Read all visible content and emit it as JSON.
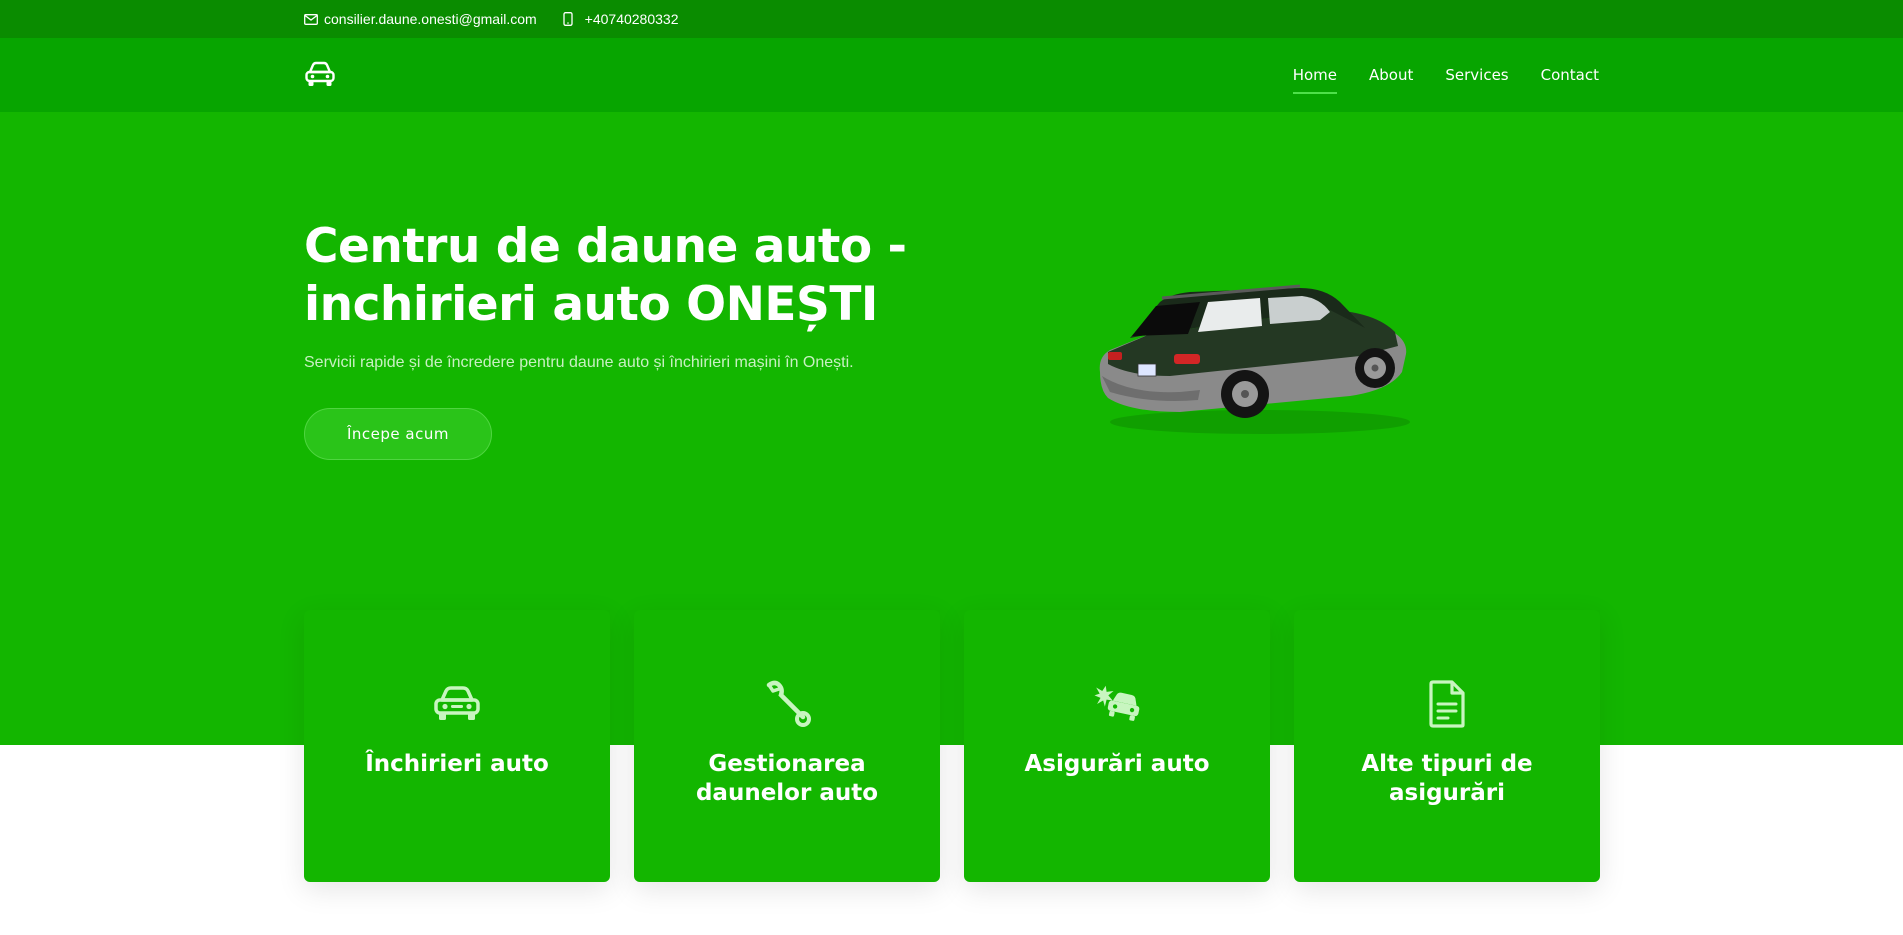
{
  "topbar": {
    "email": "consilier.daune.onesti@gmail.com",
    "phone": "+40740280332",
    "email_icon": "envelope-icon",
    "phone_icon": "phone-icon"
  },
  "header": {
    "logo_icon": "car-icon",
    "nav": [
      {
        "label": "Home",
        "active": true
      },
      {
        "label": "About",
        "active": false
      },
      {
        "label": "Services",
        "active": false
      },
      {
        "label": "Contact",
        "active": false
      }
    ]
  },
  "hero": {
    "title_line1": "Centru de daune auto -",
    "title_line2": "inchirieri auto ONEȘTI",
    "subtitle": "Servicii rapide și de încredere pentru daune auto și închirieri mașini în Onești.",
    "cta_label": "Începe acum",
    "image": "car-image"
  },
  "services": [
    {
      "icon": "car-icon",
      "title": "Închirieri auto"
    },
    {
      "icon": "wrench-icon",
      "title": "Gestionarea daunelor auto"
    },
    {
      "icon": "car-crash-icon",
      "title": "Asigurări auto"
    },
    {
      "icon": "document-icon",
      "title": "Alte tipuri de asigurări"
    }
  ],
  "colors": {
    "topbar": "#0a8c00",
    "header": "#07a500",
    "hero": "#13b600",
    "nav_underline": "#4ee04a",
    "service_icon": "#c8f5c0"
  }
}
